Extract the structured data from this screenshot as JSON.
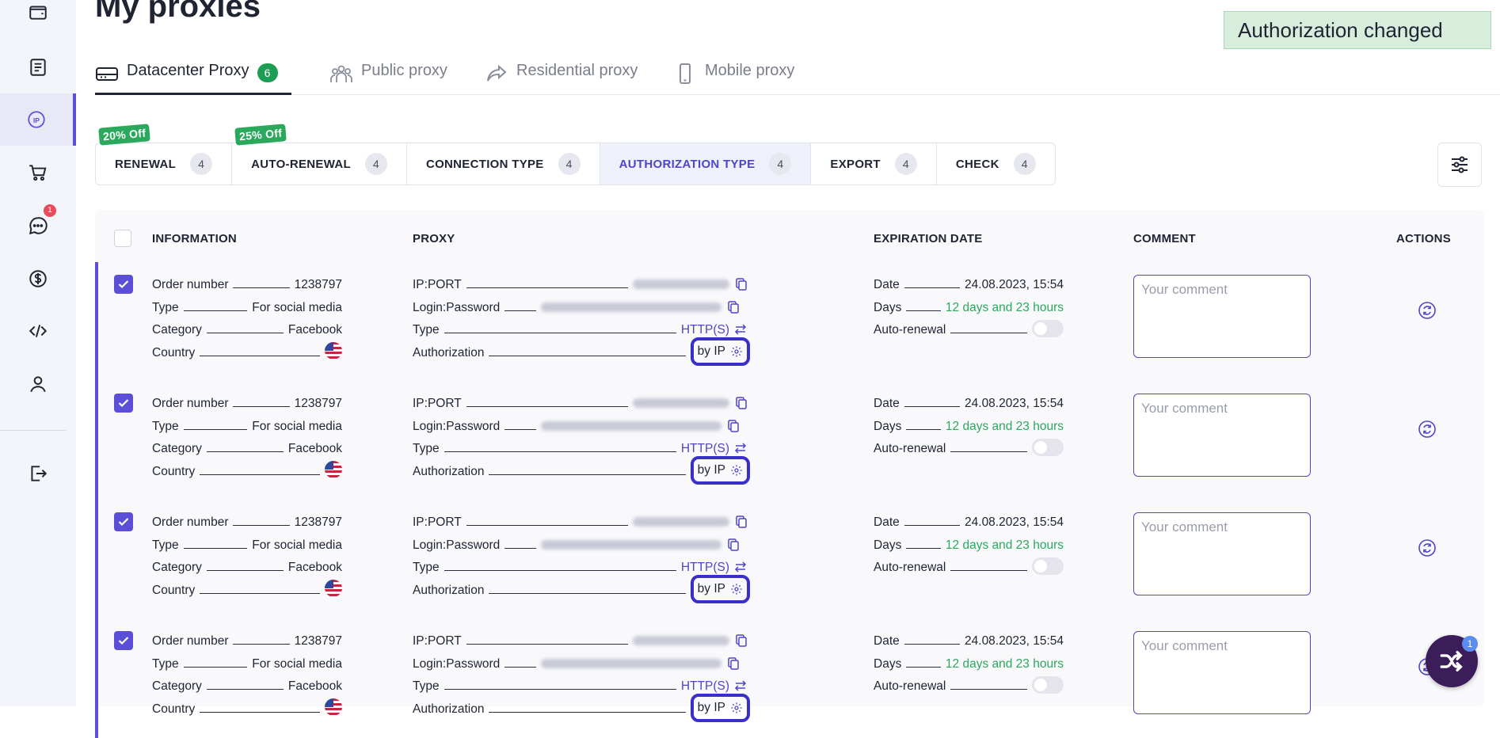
{
  "page": {
    "title": "My proxies"
  },
  "toast": {
    "text": "Authorization changed"
  },
  "sidebar": {
    "items": [
      {
        "icon": "wallet-icon"
      },
      {
        "icon": "document-icon"
      },
      {
        "icon": "ip-icon",
        "active": true
      },
      {
        "icon": "cart-icon"
      },
      {
        "icon": "chat-icon",
        "badge": "1"
      },
      {
        "icon": "dollar-icon"
      },
      {
        "icon": "code-icon"
      },
      {
        "icon": "user-icon"
      },
      {
        "icon": "logout-icon"
      }
    ]
  },
  "tabs": [
    {
      "label": "Datacenter Proxy",
      "count": "6",
      "icon": "server-icon",
      "active": true
    },
    {
      "label": "Public proxy",
      "icon": "group-icon"
    },
    {
      "label": "Residential proxy",
      "icon": "share-arrow-icon"
    },
    {
      "label": "Mobile proxy",
      "icon": "phone-icon"
    }
  ],
  "toolbar": [
    {
      "label": "RENEWAL",
      "count": "4",
      "discount": "20% Off"
    },
    {
      "label": "AUTO-RENEWAL",
      "count": "4",
      "discount": "25% Off"
    },
    {
      "label": "CONNECTION TYPE",
      "count": "4"
    },
    {
      "label": "AUTHORIZATION TYPE",
      "count": "4",
      "active": true
    },
    {
      "label": "EXPORT",
      "count": "4"
    },
    {
      "label": "CHECK",
      "count": "4"
    }
  ],
  "table": {
    "headers": {
      "information": "INFORMATION",
      "proxy": "PROXY",
      "expiration": "EXPIRATION DATE",
      "comment": "COMMENT",
      "actions": "ACTIONS"
    },
    "labels": {
      "order": "Order number",
      "type": "Type",
      "category": "Category",
      "country": "Country",
      "ipport": "IP:PORT",
      "login": "Login:Password",
      "ptype": "Type",
      "auth": "Authorization",
      "date": "Date",
      "days": "Days",
      "autorenew": "Auto-renewal",
      "comment_placeholder": "Your comment"
    },
    "rows": [
      {
        "order": "1238797",
        "type": "For social media",
        "category": "Facebook",
        "country_flag": "us-flag-icon",
        "proxy_type": "HTTP(S)",
        "auth": "by IP",
        "date": "24.08.2023, 15:54",
        "days": "12 days and 23 hours",
        "checked": true,
        "auto_renewal": false
      },
      {
        "order": "1238797",
        "type": "For social media",
        "category": "Facebook",
        "country_flag": "us-flag-icon",
        "proxy_type": "HTTP(S)",
        "auth": "by IP",
        "date": "24.08.2023, 15:54",
        "days": "12 days and 23 hours",
        "checked": true,
        "auto_renewal": false
      },
      {
        "order": "1238797",
        "type": "For social media",
        "category": "Facebook",
        "country_flag": "us-flag-icon",
        "proxy_type": "HTTP(S)",
        "auth": "by IP",
        "date": "24.08.2023, 15:54",
        "days": "12 days and 23 hours",
        "checked": true,
        "auto_renewal": false
      },
      {
        "order": "1238797",
        "type": "For social media",
        "category": "Facebook",
        "country_flag": "us-flag-icon",
        "proxy_type": "HTTP(S)",
        "auth": "by IP",
        "date": "24.08.2023, 15:54",
        "days": "12 days and 23 hours",
        "checked": true,
        "auto_renewal": false
      }
    ]
  },
  "fab": {
    "badge": "1",
    "icon": "shuffle-icon"
  },
  "colors": {
    "accent": "#5a4fd6",
    "green": "#2aa95c",
    "toast_bg": "#d7eedc"
  }
}
